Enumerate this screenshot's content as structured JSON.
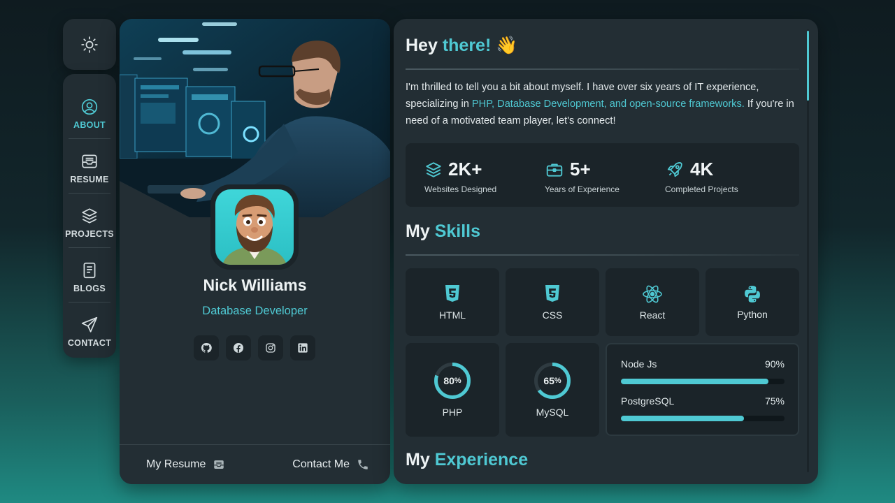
{
  "nav": {
    "theme_icon": "sun-icon",
    "items": [
      {
        "label": "ABOUT",
        "icon": "user-circle-icon",
        "active": true
      },
      {
        "label": "RESUME",
        "icon": "inbox-tray-icon",
        "active": false
      },
      {
        "label": "PROJECTS",
        "icon": "layers-icon",
        "active": false
      },
      {
        "label": "BLOGS",
        "icon": "document-icon",
        "active": false
      },
      {
        "label": "CONTACT",
        "icon": "paper-plane-icon",
        "active": false
      }
    ]
  },
  "profile": {
    "name": "Nick Williams",
    "role": "Database Developer",
    "socials": [
      "github-icon",
      "facebook-icon",
      "instagram-icon",
      "linkedin-icon"
    ],
    "resume_label": "My Resume",
    "contact_label": "Contact Me"
  },
  "about": {
    "heading_prefix": "Hey",
    "heading_accent": "there!",
    "heading_emoji": "👋",
    "intro_before": "I'm thrilled to tell you a bit about myself. I have over six years of IT experience, specializing in ",
    "intro_highlight": "PHP, Database Development, and open-source frameworks.",
    "intro_after": " If you're in need of a motivated team player, let's connect!"
  },
  "stats": [
    {
      "value": "2K+",
      "label": "Websites Designed",
      "icon": "layers-icon"
    },
    {
      "value": "5+",
      "label": "Years of Experience",
      "icon": "briefcase-icon"
    },
    {
      "value": "4K",
      "label": "Completed Projects",
      "icon": "rocket-icon"
    }
  ],
  "skills": {
    "heading_prefix": "My",
    "heading_accent": "Skills",
    "cards": [
      {
        "name": "HTML",
        "icon": "html5-icon"
      },
      {
        "name": "CSS",
        "icon": "css3-icon"
      },
      {
        "name": "React",
        "icon": "react-icon"
      },
      {
        "name": "Python",
        "icon": "python-icon"
      }
    ],
    "rings": [
      {
        "name": "PHP",
        "value": "80",
        "unit": "%",
        "fraction": 0.8
      },
      {
        "name": "MySQL",
        "value": "65",
        "unit": "%",
        "fraction": 0.65
      }
    ],
    "bars": [
      {
        "name": "Node Js",
        "value": "90%",
        "fraction": 0.9
      },
      {
        "name": "PostgreSQL",
        "value": "75%",
        "fraction": 0.75
      }
    ]
  },
  "experience": {
    "heading_prefix": "My",
    "heading_accent": "Experience"
  },
  "colors": {
    "accent": "#4fc9d3",
    "panel": "#232e34",
    "card": "#1b2429"
  }
}
